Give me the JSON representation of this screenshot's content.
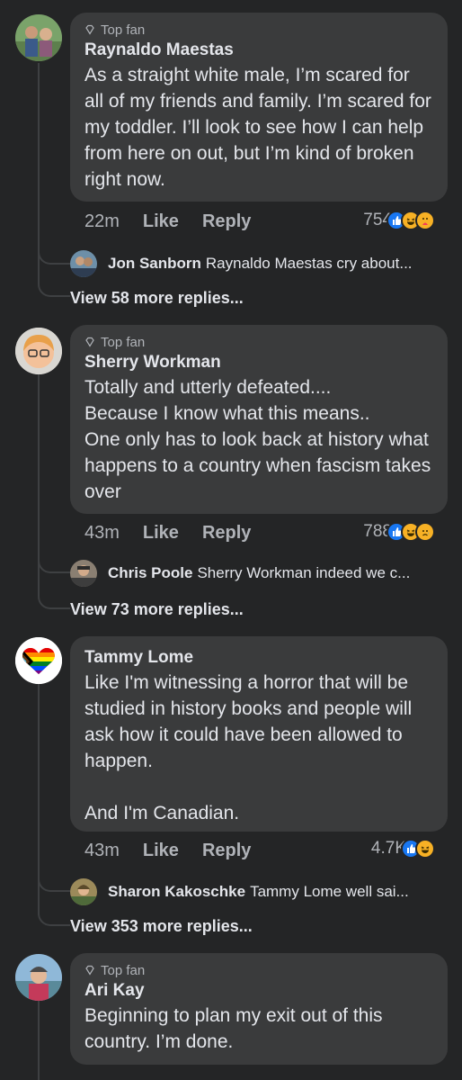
{
  "comments": [
    {
      "badge": "Top fan",
      "author": "Raynaldo Maestas",
      "text": "As a straight white male, I’m scared for all of my friends and family. I’m scared for my toddler. I’ll look to see how I can help from here on out, but I’m kind of broken right now.",
      "time": "22m",
      "like": "Like",
      "reply": "Reply",
      "reaction_count": "754",
      "reactions": [
        "like-reaction-icon",
        "haha-reaction-icon",
        "care-reaction-icon"
      ],
      "reply_preview": {
        "author": "Jon Sanborn",
        "text": "Raynaldo Maestas cry about..."
      },
      "more_replies": "View 58 more replies..."
    },
    {
      "badge": "Top fan",
      "author": "Sherry Workman",
      "text": "Totally and utterly defeated....\nBecause I know what this means..\nOne only has to look back at history what happens to a country when fascism takes over",
      "time": "43m",
      "like": "Like",
      "reply": "Reply",
      "reaction_count": "788",
      "reactions": [
        "like-reaction-icon",
        "haha-reaction-icon",
        "sad-reaction-icon"
      ],
      "reply_preview": {
        "author": "Chris Poole",
        "text": "Sherry Workman indeed we c..."
      },
      "more_replies": "View 73 more replies..."
    },
    {
      "badge": "",
      "author": "Tammy Lome",
      "text": "Like I'm witnessing a horror that will be studied in history books and people will ask how it could have been allowed to happen.\n\nAnd I'm Canadian.",
      "time": "43m",
      "like": "Like",
      "reply": "Reply",
      "reaction_count": "4.7K",
      "reactions": [
        "like-reaction-icon",
        "haha-reaction-icon"
      ],
      "reply_preview": {
        "author": "Sharon Kakoschke",
        "text": "Tammy Lome well sai..."
      },
      "more_replies": "View 353 more replies..."
    },
    {
      "badge": "Top fan",
      "author": "Ari Kay",
      "text": "Beginning to plan my exit out of this country. I’m done."
    }
  ],
  "colors": {
    "background": "#242526",
    "bubble": "#3a3b3c",
    "like_blue": "#1877f2",
    "haha_yellow": "#f7b125"
  }
}
